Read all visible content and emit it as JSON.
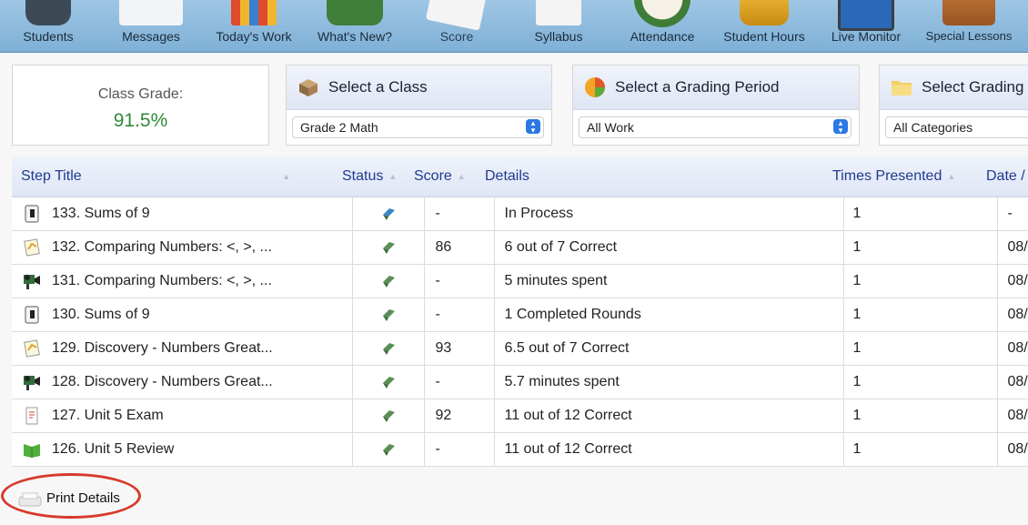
{
  "toolbar": {
    "items": [
      {
        "label": "Students",
        "icon": "students-icon"
      },
      {
        "label": "Messages",
        "icon": "messages-icon"
      },
      {
        "label": "Today's Work",
        "icon": "todays-work-icon"
      },
      {
        "label": "What's New?",
        "icon": "whats-new-icon"
      },
      {
        "label": "Score",
        "icon": "score-icon"
      },
      {
        "label": "Syllabus",
        "icon": "syllabus-icon"
      },
      {
        "label": "Attendance",
        "icon": "attendance-icon"
      },
      {
        "label": "Student Hours",
        "icon": "student-hours-icon"
      },
      {
        "label": "Live Monitor",
        "icon": "live-monitor-icon"
      },
      {
        "label": "Special Lessons",
        "icon": "special-lessons-icon"
      }
    ]
  },
  "grade": {
    "label": "Class Grade:",
    "value": "91.5%"
  },
  "selectors": [
    {
      "title": "Select a Class",
      "value": "Grade 2 Math",
      "icon": "box-icon"
    },
    {
      "title": "Select a Grading Period",
      "value": "All Work",
      "icon": "pie-chart-icon"
    },
    {
      "title": "Select Grading C",
      "value": "All Categories",
      "icon": "folder-icon"
    }
  ],
  "table": {
    "headers": {
      "step_title": "Step Title",
      "status": "Status",
      "score": "Score",
      "details": "Details",
      "times": "Times Presented",
      "date": "Date /"
    },
    "rows": [
      {
        "title": "133. Sums of 9",
        "score": "-",
        "details": "In Process",
        "times": "1",
        "date": "-",
        "type": "game-icon",
        "status": "in-progress"
      },
      {
        "title": "132. Comparing Numbers: <, >, ...",
        "score": "86",
        "details": "6 out of 7 Correct",
        "times": "1",
        "date": "08/",
        "type": "quiz-icon",
        "status": "complete"
      },
      {
        "title": "131. Comparing Numbers: <, >, ...",
        "score": "-",
        "details": "5 minutes spent",
        "times": "1",
        "date": "08/",
        "type": "video-icon",
        "status": "complete"
      },
      {
        "title": "130. Sums of 9",
        "score": "-",
        "details": "1 Completed Rounds",
        "times": "1",
        "date": "08/",
        "type": "game-icon",
        "status": "complete"
      },
      {
        "title": "129. Discovery - Numbers Great...",
        "score": "93",
        "details": "6.5 out of 7 Correct",
        "times": "1",
        "date": "08/",
        "type": "quiz-icon",
        "status": "complete"
      },
      {
        "title": "128. Discovery - Numbers Great...",
        "score": "-",
        "details": "5.7 minutes spent",
        "times": "1",
        "date": "08/",
        "type": "video-icon",
        "status": "complete"
      },
      {
        "title": "127. Unit 5 Exam",
        "score": "92",
        "details": "11 out of 12 Correct",
        "times": "1",
        "date": "08/",
        "type": "exam-icon",
        "status": "complete"
      },
      {
        "title": "126. Unit 5 Review",
        "score": "-",
        "details": "11 out of 12 Correct",
        "times": "1",
        "date": "08/",
        "type": "book-icon",
        "status": "complete"
      }
    ]
  },
  "footer": {
    "print_label": "Print Details"
  },
  "colors": {
    "grade": "#2f8a35",
    "header_text": "#203a8f",
    "status_complete": "#5a8f56",
    "status_progress": "#3a86c6",
    "annotation": "#d63a2c"
  }
}
